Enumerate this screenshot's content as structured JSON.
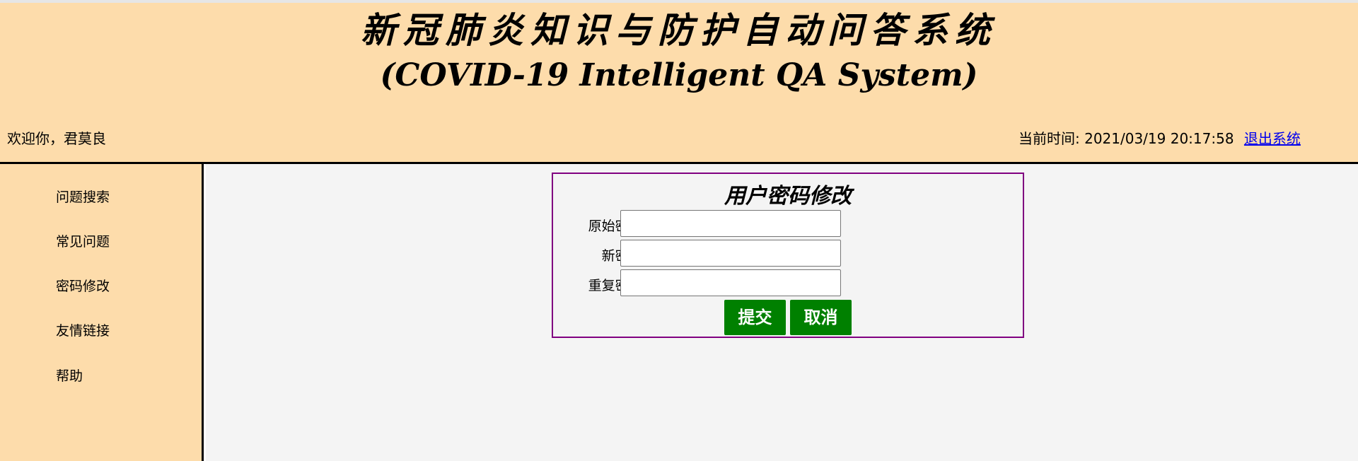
{
  "header": {
    "title_cn": "新冠肺炎知识与防护自动问答系统",
    "title_en": "(COVID-19 Intelligent QA System)",
    "welcome": "欢迎你，君莫良",
    "time_label": "当前时间: 2021/03/19 20:17:58",
    "logout": "退出系统"
  },
  "sidebar": {
    "items": [
      {
        "label": "问题搜索"
      },
      {
        "label": "常见问题"
      },
      {
        "label": "密码修改"
      },
      {
        "label": "友情链接"
      },
      {
        "label": "帮助"
      }
    ]
  },
  "password_form": {
    "title": "用户密码修改",
    "fields": [
      {
        "label": "原始密码:",
        "value": ""
      },
      {
        "label": "新密码:",
        "value": ""
      },
      {
        "label": "重复密码:",
        "value": ""
      }
    ],
    "submit_label": "提交",
    "cancel_label": "取消"
  },
  "colors": {
    "header_bg": "#fddcab",
    "content_bg": "#f4f4f4",
    "form_border": "#800080",
    "button_bg": "#008000",
    "link": "#0000ee"
  }
}
